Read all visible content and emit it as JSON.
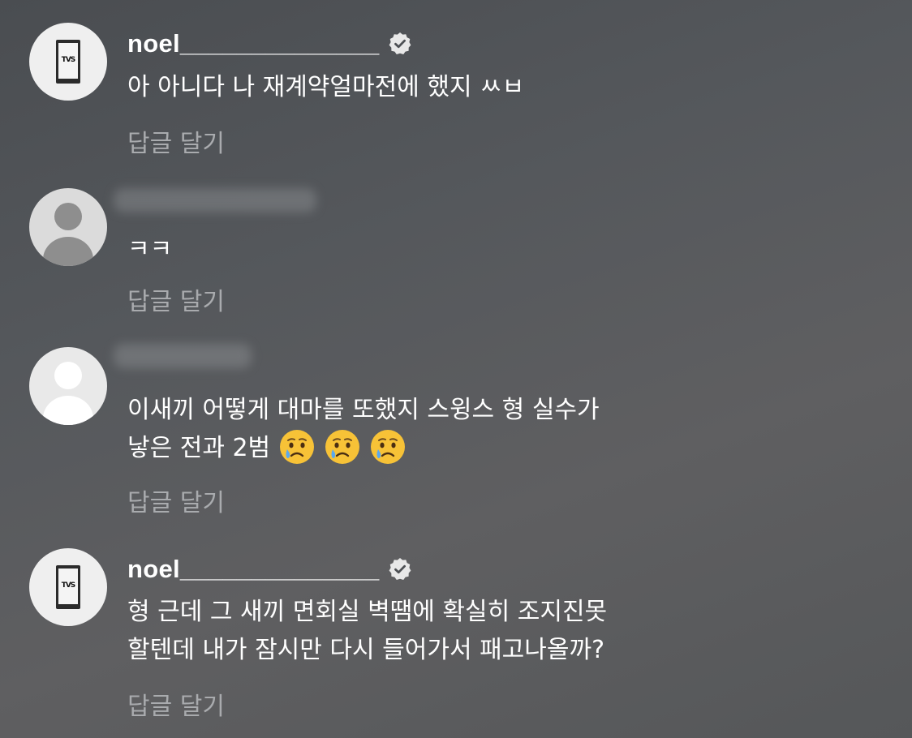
{
  "comments": [
    {
      "username": "noel______________",
      "verified": true,
      "avatar": "tvs-book-avatar",
      "lines": [
        "아 아니다 나 재계약얼마전에 했지 ㅆㅂ"
      ],
      "reply_label": "답글 달기"
    },
    {
      "username": "",
      "verified": false,
      "avatar": "default-avatar",
      "lines": [
        "ㅋㅋ"
      ],
      "reply_label": "답글 달기"
    },
    {
      "username": "",
      "verified": false,
      "avatar": "default-avatar",
      "lines": [
        "이새끼 어떻게 대마를 또했지 스윙스 형 실수가",
        "낳은 전과 2범"
      ],
      "emojis": [
        "crying-face-emoji",
        "crying-face-emoji",
        "crying-face-emoji"
      ],
      "reply_label": "답글 달기"
    },
    {
      "username": "noel______________",
      "verified": true,
      "avatar": "tvs-book-avatar",
      "lines": [
        "형 근데 그 새끼 면회실 벽땜에 확실히 조지진못",
        "할텐데 내가 잠시만 다시 들어가서 패고나올까?"
      ],
      "reply_label": "답글 달기"
    }
  ],
  "avatar_mark": "TVS"
}
